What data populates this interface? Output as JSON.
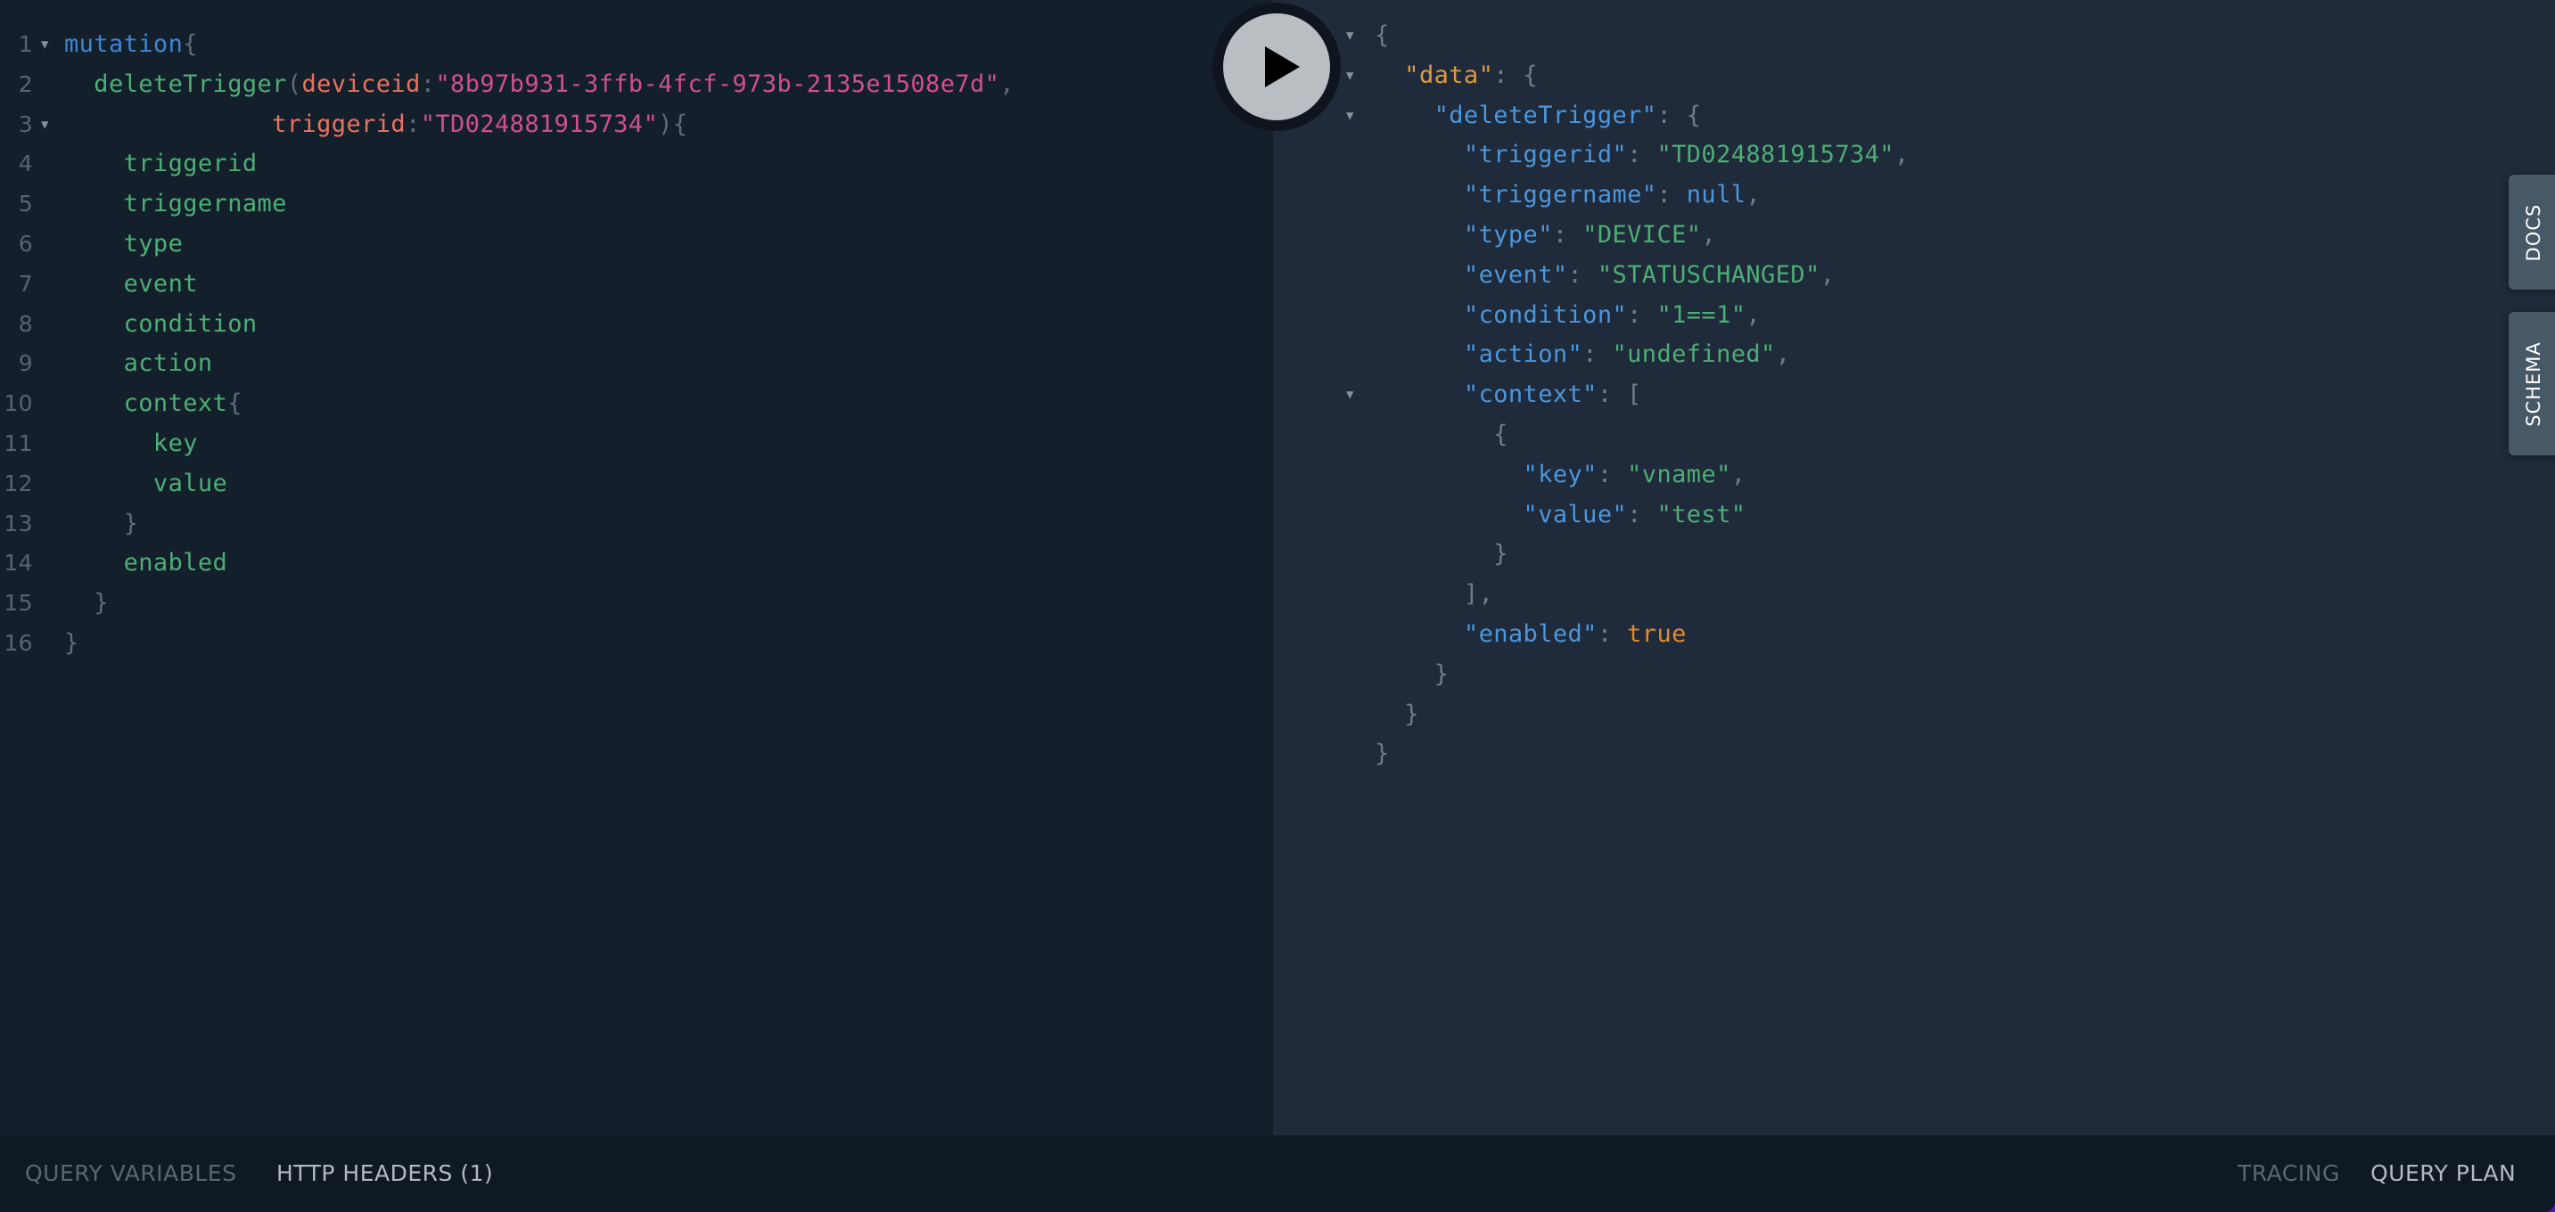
{
  "editor": {
    "lines": [
      {
        "n": "1",
        "fold": true,
        "tokens": [
          {
            "t": "mutation",
            "c": "kw"
          },
          {
            "t": "{",
            "c": "pn"
          }
        ]
      },
      {
        "n": "2",
        "fold": false,
        "tokens": [
          {
            "t": "  deleteTrigger",
            "c": "fld"
          },
          {
            "t": "(",
            "c": "pn"
          },
          {
            "t": "deviceid",
            "c": "arg"
          },
          {
            "t": ":",
            "c": "pn"
          },
          {
            "t": "\"8b97b931-3ffb-4fcf-973b-2135e1508e7d\"",
            "c": "str"
          },
          {
            "t": ",",
            "c": "pn"
          }
        ]
      },
      {
        "n": "3",
        "fold": true,
        "tokens": [
          {
            "t": "              triggerid",
            "c": "arg"
          },
          {
            "t": ":",
            "c": "pn"
          },
          {
            "t": "\"TD024881915734\"",
            "c": "str"
          },
          {
            "t": "){",
            "c": "pn"
          }
        ]
      },
      {
        "n": "4",
        "fold": false,
        "tokens": [
          {
            "t": "    triggerid",
            "c": "fld"
          }
        ]
      },
      {
        "n": "5",
        "fold": false,
        "tokens": [
          {
            "t": "    triggername",
            "c": "fld"
          }
        ]
      },
      {
        "n": "6",
        "fold": false,
        "tokens": [
          {
            "t": "    type",
            "c": "fld"
          }
        ]
      },
      {
        "n": "7",
        "fold": false,
        "tokens": [
          {
            "t": "    event",
            "c": "fld"
          }
        ]
      },
      {
        "n": "8",
        "fold": false,
        "tokens": [
          {
            "t": "    condition",
            "c": "fld"
          }
        ]
      },
      {
        "n": "9",
        "fold": false,
        "tokens": [
          {
            "t": "    action",
            "c": "fld"
          }
        ]
      },
      {
        "n": "10",
        "fold": false,
        "tokens": [
          {
            "t": "    context",
            "c": "fld"
          },
          {
            "t": "{",
            "c": "pn"
          }
        ]
      },
      {
        "n": "11",
        "fold": false,
        "tokens": [
          {
            "t": "      key",
            "c": "fld"
          }
        ]
      },
      {
        "n": "12",
        "fold": false,
        "tokens": [
          {
            "t": "      value",
            "c": "fld"
          }
        ]
      },
      {
        "n": "13",
        "fold": false,
        "tokens": [
          {
            "t": "    }",
            "c": "pn"
          }
        ]
      },
      {
        "n": "14",
        "fold": false,
        "tokens": [
          {
            "t": "    enabled",
            "c": "fld"
          }
        ]
      },
      {
        "n": "15",
        "fold": false,
        "tokens": [
          {
            "t": "  }",
            "c": "pn"
          }
        ]
      },
      {
        "n": "16",
        "fold": false,
        "tokens": [
          {
            "t": "}",
            "c": "pn"
          }
        ]
      }
    ]
  },
  "run_button": {
    "icon": "play-icon"
  },
  "result": {
    "lines": [
      {
        "fold": true,
        "tokens": [
          {
            "t": "{",
            "c": "jp"
          }
        ]
      },
      {
        "fold": true,
        "tokens": [
          {
            "t": "  \"data\"",
            "c": "jdata"
          },
          {
            "t": ": {",
            "c": "jp"
          }
        ]
      },
      {
        "fold": true,
        "tokens": [
          {
            "t": "    \"deleteTrigger\"",
            "c": "jkey"
          },
          {
            "t": ": {",
            "c": "jp"
          }
        ]
      },
      {
        "fold": false,
        "tokens": [
          {
            "t": "      \"triggerid\"",
            "c": "jkey"
          },
          {
            "t": ": ",
            "c": "jp"
          },
          {
            "t": "\"TD024881915734\"",
            "c": "jstr"
          },
          {
            "t": ",",
            "c": "jp"
          }
        ]
      },
      {
        "fold": false,
        "tokens": [
          {
            "t": "      \"triggername\"",
            "c": "jkey"
          },
          {
            "t": ": ",
            "c": "jp"
          },
          {
            "t": "null",
            "c": "jnull"
          },
          {
            "t": ",",
            "c": "jp"
          }
        ]
      },
      {
        "fold": false,
        "tokens": [
          {
            "t": "      \"type\"",
            "c": "jkey"
          },
          {
            "t": ": ",
            "c": "jp"
          },
          {
            "t": "\"DEVICE\"",
            "c": "jstr"
          },
          {
            "t": ",",
            "c": "jp"
          }
        ]
      },
      {
        "fold": false,
        "tokens": [
          {
            "t": "      \"event\"",
            "c": "jkey"
          },
          {
            "t": ": ",
            "c": "jp"
          },
          {
            "t": "\"STATUSCHANGED\"",
            "c": "jstr"
          },
          {
            "t": ",",
            "c": "jp"
          }
        ]
      },
      {
        "fold": false,
        "tokens": [
          {
            "t": "      \"condition\"",
            "c": "jkey"
          },
          {
            "t": ": ",
            "c": "jp"
          },
          {
            "t": "\"1==1\"",
            "c": "jstr"
          },
          {
            "t": ",",
            "c": "jp"
          }
        ]
      },
      {
        "fold": false,
        "tokens": [
          {
            "t": "      \"action\"",
            "c": "jkey"
          },
          {
            "t": ": ",
            "c": "jp"
          },
          {
            "t": "\"undefined\"",
            "c": "jstr"
          },
          {
            "t": ",",
            "c": "jp"
          }
        ]
      },
      {
        "fold": true,
        "tokens": [
          {
            "t": "      \"context\"",
            "c": "jkey"
          },
          {
            "t": ": [",
            "c": "jp"
          }
        ]
      },
      {
        "fold": false,
        "tokens": [
          {
            "t": "        {",
            "c": "jp"
          }
        ]
      },
      {
        "fold": false,
        "tokens": [
          {
            "t": "          \"key\"",
            "c": "jkey"
          },
          {
            "t": ": ",
            "c": "jp"
          },
          {
            "t": "\"vname\"",
            "c": "jstr"
          },
          {
            "t": ",",
            "c": "jp"
          }
        ]
      },
      {
        "fold": false,
        "tokens": [
          {
            "t": "          \"value\"",
            "c": "jkey"
          },
          {
            "t": ": ",
            "c": "jp"
          },
          {
            "t": "\"test\"",
            "c": "jstr"
          }
        ]
      },
      {
        "fold": false,
        "tokens": [
          {
            "t": "        }",
            "c": "jp"
          }
        ]
      },
      {
        "fold": false,
        "tokens": [
          {
            "t": "      ],",
            "c": "jp"
          }
        ]
      },
      {
        "fold": false,
        "tokens": [
          {
            "t": "      \"enabled\"",
            "c": "jkey"
          },
          {
            "t": ": ",
            "c": "jp"
          },
          {
            "t": "true",
            "c": "jbool"
          }
        ]
      },
      {
        "fold": false,
        "tokens": [
          {
            "t": "    }",
            "c": "jp"
          }
        ]
      },
      {
        "fold": false,
        "tokens": [
          {
            "t": "  }",
            "c": "jp"
          }
        ]
      },
      {
        "fold": false,
        "tokens": [
          {
            "t": "}",
            "c": "jp"
          }
        ]
      }
    ]
  },
  "side_tabs": {
    "docs": "DOCS",
    "schema": "SCHEMA"
  },
  "bottom_bar": {
    "query_variables": "QUERY VARIABLES",
    "http_headers": "HTTP HEADERS (1)",
    "tracing": "TRACING",
    "query_plan": "QUERY PLAN"
  },
  "colors": {
    "editor_bg": "#141f2c",
    "result_bg": "#1f2a3a",
    "bottom_bar_bg": "#0f1923",
    "side_tab_bg": "#475866",
    "accent_purple": "#3f20ba"
  }
}
